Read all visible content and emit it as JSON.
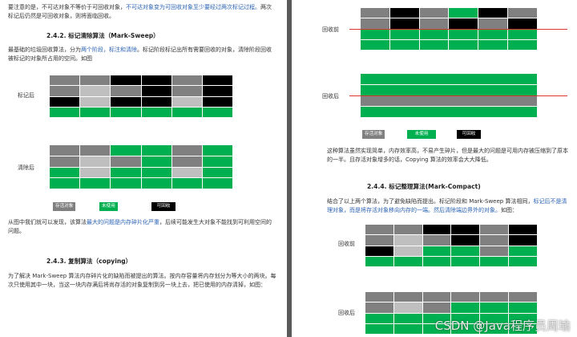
{
  "left": {
    "intro_1": "要注意的是，不可达对象不等价于可回收对象，",
    "intro_1_blue": "不可达对象变为可回收对象至少要经过两次标记过程。",
    "intro_2": "两次标记后仍然是可回收对象，则将面临回收。",
    "sec1_title": "2.4.2. 标记清除算法（Mark-Sweep）",
    "sec1_p1_a": "最基础的垃圾回收算法，分为",
    "sec1_p1_blue": "两个阶段，标注和清除",
    "sec1_p1_b": "。标记阶段标记出所有需要回收的对象，清除阶段回收被标记的对象所占用的空间。如图",
    "label_marked": "标记后",
    "label_cleared": "清除后",
    "legend": {
      "alive": "存活对象",
      "unused": "未使用",
      "recyclable": "可回收"
    },
    "sec1_p2_a": "从图中我们就可以发现，该算法",
    "sec1_p2_blue": "最大的问题是内存碎片化严重",
    "sec1_p2_b": "，后续可能发生大对象不能找到可利用空间的问题。",
    "sec2_title": "2.4.3. 复制算法（copying）",
    "sec2_p1": "为了解决 Mark-Sweep 算法内存碎片化的缺陷而被提出的算法。按内存容量将内存划分为等大小的两块。每次只使用其中一块，当这一块内存满后将尚存活的对象复制到另一块上去，把已使用的内存清掉，如图："
  },
  "right": {
    "label_before": "回收前",
    "label_after": "回收后",
    "legend": {
      "alive": "存活对象",
      "unused": "未使用",
      "recyclable": "可回收"
    },
    "p1": "这种算法虽然实现简单，内存效率高，不易产生碎片，但是最大的问题是可用内存被压缩到了原本的一半。且存活对象增多的话，Copying 算法的效率会大大降低。",
    "sec3_title": "2.4.4. 标记整理算法(Mark-Compact)",
    "sec3_p1_a": "结合了以上两个算法，为了避免缺陷而提出。标记阶段和 Mark-Sweep 算法相同，",
    "sec3_p1_blue": "标记后不是清理对象，而是将存活对象移向内存的一端。然后清除端边界外的对象。",
    "sec3_p1_b": "如图：",
    "label_before2": "回收前",
    "label_after2": "回收后"
  },
  "watermark": "CSDN @Java程序员周瑜",
  "colors": {
    "alive": "#808080",
    "unused": "#00b050",
    "recyclable": "#000000",
    "accent": "#2b63b5",
    "divider": "#d9362e"
  }
}
